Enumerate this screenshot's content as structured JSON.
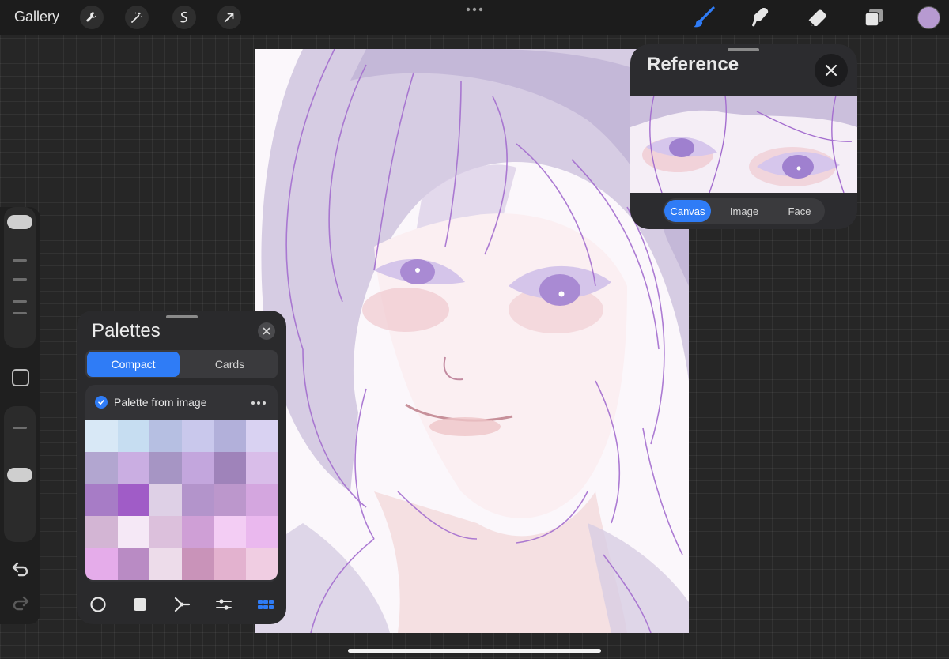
{
  "topbar": {
    "gallery_label": "Gallery",
    "actions": [
      "wrench-icon",
      "magic-wand-icon",
      "selection-icon",
      "transform-arrow-icon"
    ],
    "tools": [
      "brush-icon",
      "smudge-icon",
      "eraser-icon",
      "layers-icon"
    ],
    "active_tool": "brush-icon",
    "current_color": "#b79ad1",
    "accent_color": "#2f7cf6"
  },
  "sidebar": {
    "brush_size_slider": "Brush size",
    "brush_opacity_slider": "Opacity",
    "undo_icon": "undo-icon",
    "redo_icon": "redo-icon",
    "modify_icon": "square-modify-icon"
  },
  "reference": {
    "title": "Reference",
    "tabs": [
      {
        "label": "Canvas",
        "active": true
      },
      {
        "label": "Image",
        "active": false
      },
      {
        "label": "Face",
        "active": false
      }
    ]
  },
  "palettes": {
    "title": "Palettes",
    "tabs": [
      {
        "label": "Compact",
        "active": true
      },
      {
        "label": "Cards",
        "active": false
      }
    ],
    "palette_name": "Palette from image",
    "swatches": [
      "#d8e8f6",
      "#c6ddf1",
      "#b6bfe2",
      "#c9c8ec",
      "#b2b0da",
      "#d9d2f2",
      "#b2a6d0",
      "#caaee2",
      "#a695c4",
      "#c3a6dd",
      "#9f83ba",
      "#d9bde9",
      "#a77cc6",
      "#a05cc7",
      "#ded0e6",
      "#b394cb",
      "#bc97cc",
      "#d4a6df",
      "#d3b5d4",
      "#f5e8f6",
      "#dcc0dc",
      "#cf9fd6",
      "#f3cdf4",
      "#eab8ee",
      "#e5acea",
      "#b98bc4",
      "#eddcea",
      "#c993b9",
      "#e3b2cf",
      "#f0cde2"
    ],
    "bottom_icons": [
      "disc-icon",
      "classic-icon",
      "harmony-icon",
      "value-icon",
      "palettes-icon"
    ],
    "active_bottom": "palettes-icon"
  }
}
